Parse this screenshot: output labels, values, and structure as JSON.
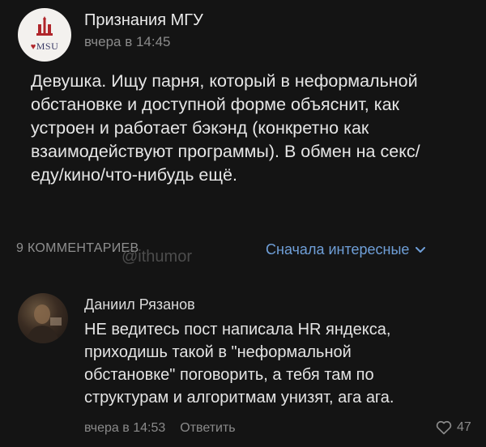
{
  "post": {
    "group_name": "Признания МГУ",
    "time": "вчера в 14:45",
    "avatar_text": "MSU",
    "avatar_heart": "♥",
    "text_lines": [
      "Девушка. Ищу парня, который в неформальной",
      "обстановке и доступной форме объяснит, как",
      "устроен и работает бэкэнд (конкретно как",
      "взаимодействуют программы). В обмен на секс/",
      "еду/кино/что-нибудь ещё."
    ]
  },
  "comments_bar": {
    "count_label": "9 КОММЕНТАРИЕВ",
    "watermark": "@ithumor",
    "sort_label": "Сначала интересные"
  },
  "comment": {
    "author": "Даниил Рязанов",
    "text_lines": [
      "НЕ ведитесь пост написала HR яндекса,",
      "приходишь такой в \"неформальной",
      "обстановке\" поговорить, а тебя там по",
      "структурам и алгоритмам унизят, ага ага."
    ],
    "time": "вчера в 14:53",
    "reply_label": "Ответить",
    "likes": "47"
  },
  "colors": {
    "background": "#141414",
    "link_blue": "#6f9fd8",
    "muted": "#8a8a8a"
  },
  "icons": {
    "sort": "chevron-down-icon",
    "like": "heart-icon",
    "group_avatar": "msu-emblem-icon"
  }
}
